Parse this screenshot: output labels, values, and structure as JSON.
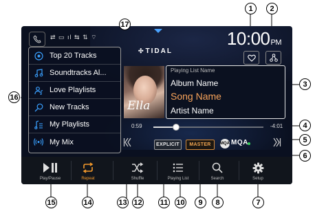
{
  "status": {
    "clock_time": "10:00",
    "clock_ampm": "PM",
    "status_icons": "⇄ ▭ ıl ⇆ ⇅ ⌔"
  },
  "service": {
    "name": "TIDAL",
    "logo_glyph": "✣"
  },
  "sidebar": {
    "items": [
      {
        "label": "Top 20 Tracks",
        "icon": "target-icon"
      },
      {
        "label": "Soundtracks Al...",
        "icon": "music-note-icon"
      },
      {
        "label": "Love Playlists",
        "icon": "user-music-icon"
      },
      {
        "label": "New Tracks",
        "icon": "search-key-icon"
      },
      {
        "label": "My Playlists",
        "icon": "playlist-icon"
      },
      {
        "label": "My Mix",
        "icon": "radio-waves-icon"
      }
    ]
  },
  "album": {
    "signature": "Ella"
  },
  "track": {
    "playing_list_name": "Playing List Name",
    "album_name": "Album Name",
    "song_name": "Song Name",
    "artist_name": "Artist Name",
    "elapsed": "0:59",
    "remaining": "-4:01",
    "progress_fraction": 0.2
  },
  "badges": {
    "explicit": "EXPLICIT",
    "master": "MASTER",
    "mqa_icon": "MQA",
    "mqa": "MQA"
  },
  "controls": {
    "play_pause": "Play/Pause",
    "repeat": "Repeat",
    "shuffle": "Shuffle",
    "playing_list": "Playing List",
    "search": "Search",
    "setup": "Setup"
  },
  "callouts": {
    "c1": "1",
    "c2": "2",
    "c3": "3",
    "c4": "4",
    "c5": "5",
    "c6": "6",
    "c7": "7",
    "c8": "8",
    "c9": "9",
    "c10": "10",
    "c11": "11",
    "c12": "12",
    "c13": "13",
    "c14": "14",
    "c15": "15",
    "c16": "16",
    "c17": "17"
  },
  "colors": {
    "accent": "#f59a2b",
    "song": "#f7a35a",
    "mqa_dot": "#36d15a",
    "screen_bg": "#0a1020"
  }
}
